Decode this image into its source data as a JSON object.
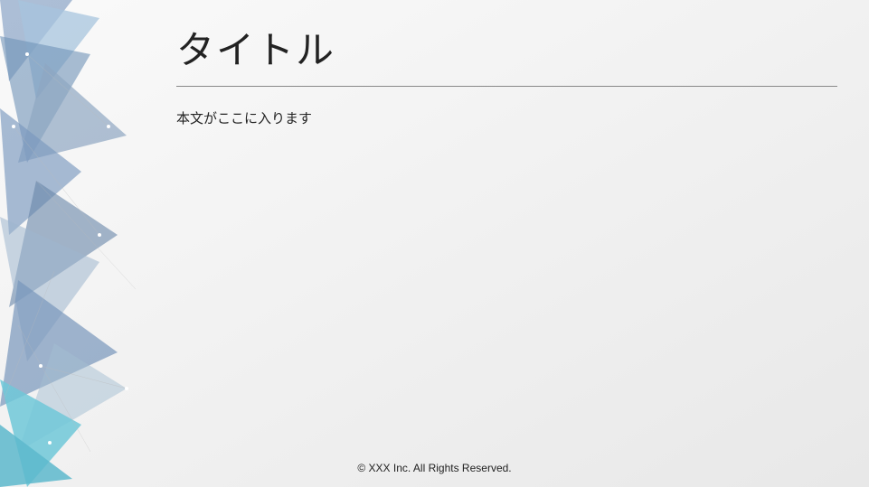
{
  "slide": {
    "title": "タイトル",
    "body": "本文がここに入ります",
    "footer": "© XXX Inc. All Rights Reserved."
  }
}
